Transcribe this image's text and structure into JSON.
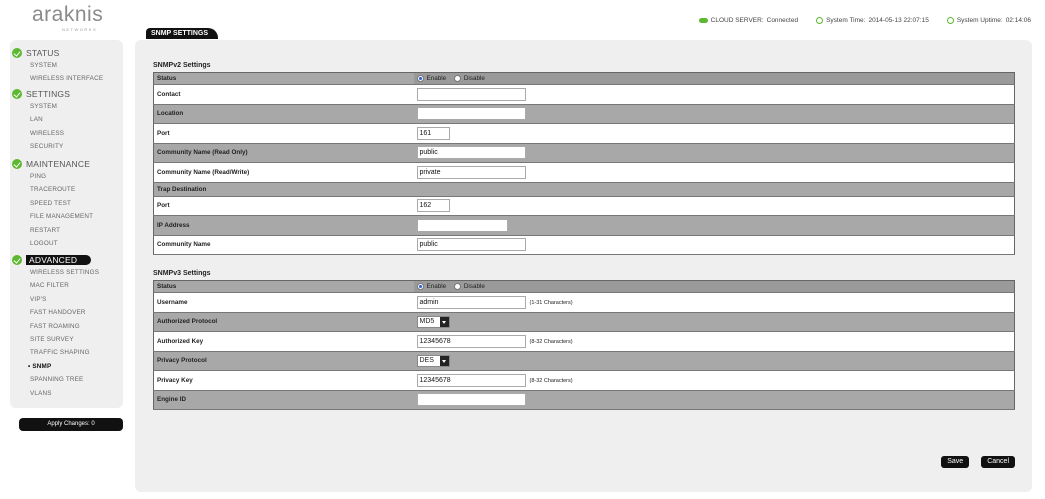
{
  "brand": {
    "logo_text": "araknis",
    "logo_sub": "NETWORKS"
  },
  "status_bar": {
    "cloud_label": "CLOUD SERVER:",
    "cloud_value": "Connected",
    "time_label": "System Time:",
    "time_value": "2014-05-13 22:07:15",
    "uptime_label": "System Uptime:",
    "uptime_value": "02:14:06"
  },
  "colors": {
    "accent_green": "#5cb830",
    "dark": "#111111",
    "panel": "#efefef",
    "row_gray": "#a8a8a8"
  },
  "sidebar": {
    "groups": [
      {
        "title": "STATUS",
        "items": [
          "SYSTEM",
          "WIRELESS INTERFACE"
        ]
      },
      {
        "title": "SETTINGS",
        "items": [
          "SYSTEM",
          "LAN",
          "WIRELESS",
          "SECURITY"
        ]
      },
      {
        "title": "MAINTENANCE",
        "items": [
          "PING",
          "TRACEROUTE",
          "SPEED TEST",
          "FILE MANAGEMENT",
          "RESTART",
          "LOGOUT"
        ]
      },
      {
        "title": "ADVANCED",
        "items": [
          "WIRELESS SETTINGS",
          "MAC FILTER",
          "VIP'S",
          "FAST HANDOVER",
          "FAST ROAMING",
          "SITE SURVEY",
          "TRAFFIC SHAPING",
          "• SNMP",
          "SPANNING TREE",
          "VLANS"
        ]
      }
    ],
    "apply_label": "Apply Changes: 0"
  },
  "page_tab": "SNMP SETTINGS",
  "v2": {
    "title": "SNMPv2 Settings",
    "status_label": "Status",
    "enable": "Enable",
    "disable": "Disable",
    "contact_label": "Contact",
    "contact_value": "",
    "location_label": "Location",
    "location_value": "",
    "port_label": "Port",
    "port_value": "161",
    "ro_label": "Community Name (Read Only)",
    "ro_value": "public",
    "rw_label": "Community Name (Read/Write)",
    "rw_value": "private",
    "trap_label": "Trap Destination",
    "trap_port_label": "Port",
    "trap_port_value": "162",
    "ip_label": "IP Address",
    "ip_value": "",
    "cn_label": "Community Name",
    "cn_value": "public"
  },
  "v3": {
    "title": "SNMPv3 Settings",
    "status_label": "Status",
    "enable": "Enable",
    "disable": "Disable",
    "user_label": "Username",
    "user_value": "admin",
    "user_hint": "(1-31 Characters)",
    "auth_proto_label": "Authorized Protocol",
    "auth_proto_value": "MD5",
    "auth_key_label": "Authorized Key",
    "auth_key_value": "12345678",
    "auth_key_hint": "(8-32 Characters)",
    "priv_proto_label": "Privacy Protocol",
    "priv_proto_value": "DES",
    "priv_key_label": "Privacy Key",
    "priv_key_value": "12345678",
    "priv_key_hint": "(8-32 Characters)",
    "engine_label": "Engine ID",
    "engine_value": ""
  },
  "buttons": {
    "save": "Save",
    "cancel": "Cancel"
  }
}
